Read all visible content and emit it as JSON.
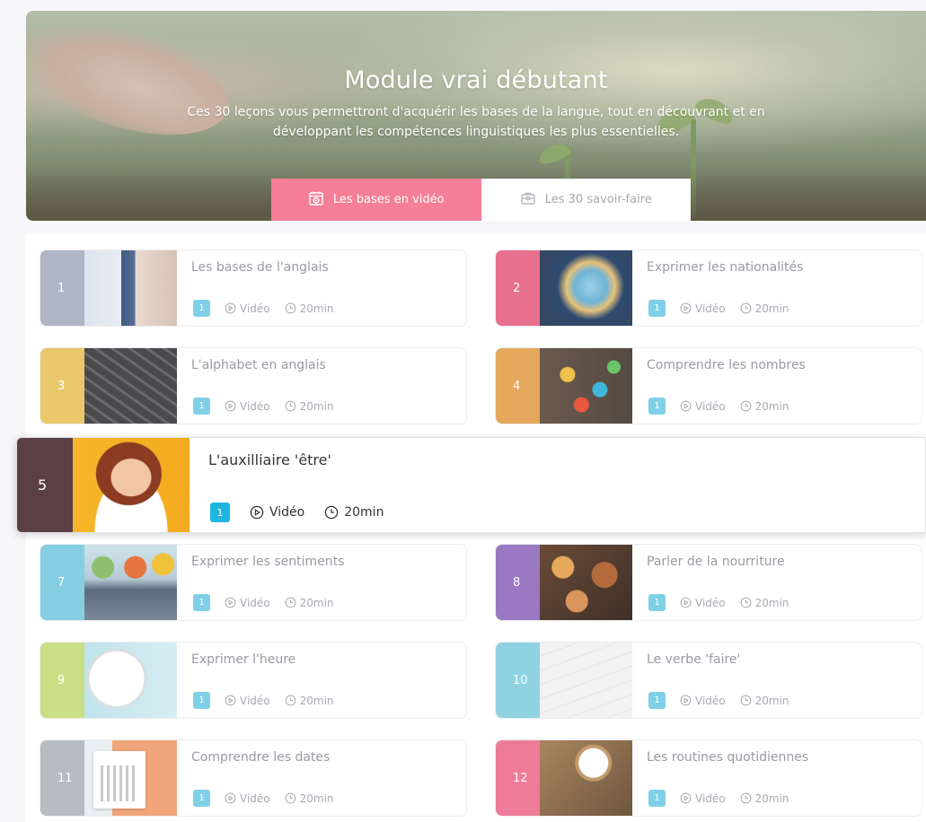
{
  "hero": {
    "title": "Module vrai débutant",
    "subtitle": "Ces 30 leçons vous permettront d'acquérir les bases de la langue, tout en découvrant et en développant les compétences linguistiques les plus essentielles."
  },
  "tabs": [
    {
      "label": "Les bases en vidéo",
      "active": true,
      "icon": "video-tutorial-icon"
    },
    {
      "label": "Les 30 savoir-faire",
      "active": false,
      "icon": "briefcase-icon"
    }
  ],
  "lessons": [
    {
      "number": "1",
      "title": "Les bases de l'anglais",
      "badge": "1",
      "type": "Vidéo",
      "duration": "20min",
      "color": "#aeb6c6"
    },
    {
      "number": "2",
      "title": "Exprimer les nationalités",
      "badge": "1",
      "type": "Vidéo",
      "duration": "20min",
      "color": "#e7708d"
    },
    {
      "number": "3",
      "title": "L'alphabet en anglais",
      "badge": "1",
      "type": "Vidéo",
      "duration": "20min",
      "color": "#e8c86a"
    },
    {
      "number": "4",
      "title": "Comprendre les nombres",
      "badge": "1",
      "type": "Vidéo",
      "duration": "20min",
      "color": "#e4a95c"
    },
    {
      "number": "5",
      "title": "L'auxilliaire 'être'",
      "badge": "1",
      "type": "Vidéo",
      "duration": "20min",
      "color": "#5b3f44"
    },
    {
      "number": "7",
      "title": "Exprimer les sentiments",
      "badge": "1",
      "type": "Vidéo",
      "duration": "20min",
      "color": "#86cfe2"
    },
    {
      "number": "8",
      "title": "Parler de la nourriture",
      "badge": "1",
      "type": "Vidéo",
      "duration": "20min",
      "color": "#9a79c2"
    },
    {
      "number": "9",
      "title": "Exprimer l'heure",
      "badge": "1",
      "type": "Vidéo",
      "duration": "20min",
      "color": "#c9df86"
    },
    {
      "number": "10",
      "title": "Le verbe 'faire'",
      "badge": "1",
      "type": "Vidéo",
      "duration": "20min",
      "color": "#8fd3e3"
    },
    {
      "number": "11",
      "title": "Comprendre les dates",
      "badge": "1",
      "type": "Vidéo",
      "duration": "20min",
      "color": "#b5bcc2"
    },
    {
      "number": "12",
      "title": "Les routines quotidiennes",
      "badge": "1",
      "type": "Vidéo",
      "duration": "20min",
      "color": "#ee7c98"
    }
  ]
}
